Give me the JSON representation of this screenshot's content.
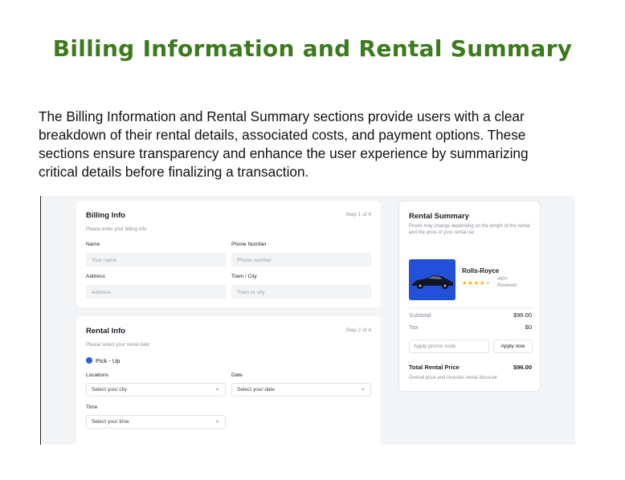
{
  "document": {
    "title": "Billing Information and Rental Summary",
    "paragraph": "The Billing Information and Rental Summary sections provide users with a clear breakdown of their rental details, associated costs, and payment options. These sections ensure transparency and enhance the user experience by summarizing critical details before finalizing a transaction."
  },
  "billing": {
    "title": "Billing Info",
    "subtitle": "Please enter your billing info",
    "step": "Step 1 of 4",
    "fields": {
      "name": {
        "label": "Name",
        "placeholder": "Your name"
      },
      "phone": {
        "label": "Phone Number",
        "placeholder": "Phone number"
      },
      "address": {
        "label": "Address",
        "placeholder": "Address"
      },
      "town": {
        "label": "Town / City",
        "placeholder": "Town or city"
      }
    }
  },
  "rental": {
    "title": "Rental Info",
    "subtitle": "Please select your rental date",
    "step": "Step 2 of 4",
    "option": "Pick - Up",
    "locations": {
      "label": "Locations",
      "value": "Select your city"
    },
    "date": {
      "label": "Date",
      "value": "Select your date"
    },
    "time": {
      "label": "Time",
      "value": "Select your time"
    }
  },
  "summary": {
    "title": "Rental Summary",
    "subtitle": "Prices may change depending on the length of the rental and the price of your rental car",
    "car": {
      "name": "Rolls-Royce",
      "rating": 4,
      "reviews": "440+ Reviewer"
    },
    "subtotal": {
      "label": "Subtotal",
      "value": "$96.00"
    },
    "tax": {
      "label": "Tax",
      "value": "$0"
    },
    "promo_placeholder": "Apply promo code",
    "promo_button": "Apply now",
    "total": {
      "label": "Total Rental Price",
      "value": "$96.00"
    },
    "total_note": "Overall price and includes rental discount"
  },
  "colors": {
    "title_green": "#3c7a1e",
    "accent_blue": "#2f5fd7",
    "star": "#f5b400"
  },
  "icons": {
    "select": "chevron-down-icon",
    "rating": "star-icon"
  }
}
